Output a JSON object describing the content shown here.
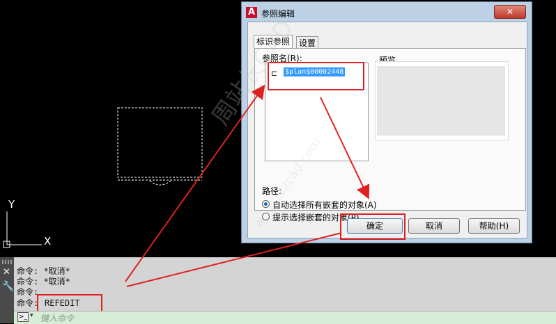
{
  "dialog": {
    "title": "参照编辑",
    "close_label": "✕",
    "tabs": [
      {
        "label": "标识参照"
      },
      {
        "label": "设置"
      }
    ],
    "ref_name_label": "参照名(R):",
    "ref_item": "$plan$00002448",
    "preview_label": "预览",
    "path_label": "路径:",
    "options": [
      {
        "label": "自动选择所有嵌套的对象(A)",
        "selected": true
      },
      {
        "label": "提示选择嵌套的对象(P)",
        "selected": false
      }
    ],
    "buttons": {
      "ok": "确定",
      "cancel": "取消",
      "help": "帮助(H)"
    }
  },
  "canvas": {
    "axis_x": "X",
    "axis_y": "Y"
  },
  "command": {
    "lines": [
      "命令: *取消*",
      "命令: *取消*",
      "命令:",
      "命令: "
    ],
    "last_command": "REFEDIT",
    "placeholder": "键入命令"
  },
  "watermark": {
    "text": "周站长CAD",
    "url": "www.zzzcad.com"
  },
  "colors": {
    "highlight_red": "#e02020",
    "selection_blue": "#3399ff",
    "title_bg": "#bcd0e6"
  }
}
